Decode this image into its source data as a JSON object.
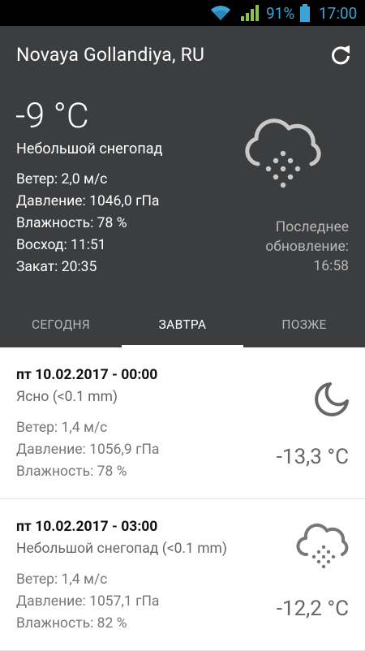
{
  "status_bar": {
    "battery_percent": "91%",
    "time": "17:00"
  },
  "header": {
    "city": "Novaya Gollandiya, RU",
    "temperature": "-9 °C",
    "condition": "Небольшой снегопад",
    "details": [
      "Ветер: 2,0 м/с",
      "Давление: 1046,0 гПа",
      "Влажность: 78 %",
      "Восход: 11:51",
      "Закат: 20:35"
    ],
    "last_update_label": "Последнее обновление:",
    "last_update_time": "16:58",
    "icon": "snow-cloud-icon"
  },
  "tabs": [
    {
      "label": "СЕГОДНЯ",
      "active": false
    },
    {
      "label": "ЗАВТРА",
      "active": true
    },
    {
      "label": "ПОЗЖЕ",
      "active": false
    }
  ],
  "forecast": [
    {
      "datetime": "пт 10.02.2017 - 00:00",
      "condition": "Ясно (<0.1 mm)",
      "wind": "Ветер: 1,4 м/с",
      "pressure": "Давление: 1056,9 гПа",
      "humidity": "Влажность: 78 %",
      "temperature": "-13,3 °C",
      "icon": "crescent-moon-icon"
    },
    {
      "datetime": "пт 10.02.2017 - 03:00",
      "condition": "Небольшой снегопад (<0.1 mm)",
      "wind": "Ветер: 1,4 м/с",
      "pressure": "Давление: 1057,1 гПа",
      "humidity": "Влажность: 82 %",
      "temperature": "-12,2 °C",
      "icon": "snow-cloud-icon"
    }
  ],
  "colors": {
    "header_bg": "#3b3d3f",
    "status_accent": "#3aa3d8",
    "signal_green": "#8bc34a"
  }
}
